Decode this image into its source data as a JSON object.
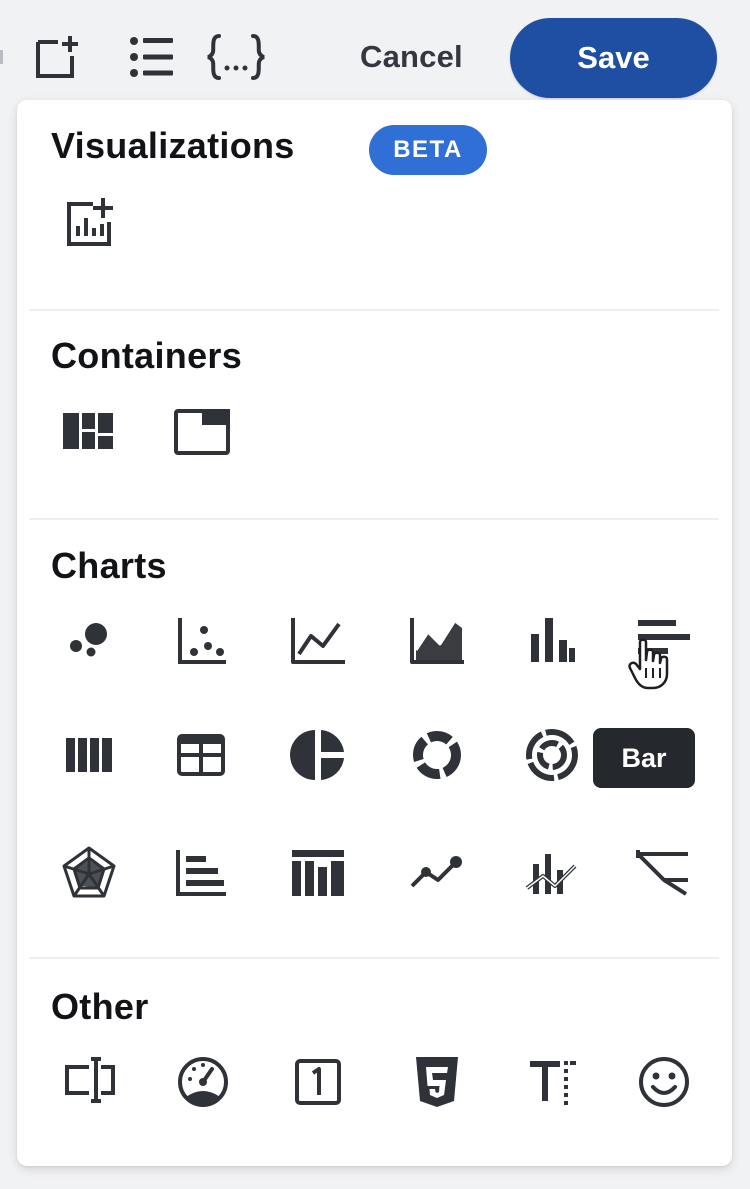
{
  "toolbar": {
    "cancel_label": "Cancel",
    "save_label": "Save",
    "icons": [
      "add-panel-icon",
      "list-icon",
      "variables-icon"
    ]
  },
  "sections": {
    "visualizations": {
      "title": "Visualizations",
      "badge": "BETA",
      "icons": [
        "add-visualization-icon"
      ]
    },
    "containers": {
      "title": "Containers",
      "icons": [
        "grid-layout-icon",
        "tabs-container-icon"
      ]
    },
    "charts": {
      "title": "Charts",
      "icons": [
        "bubble-chart-icon",
        "scatter-chart-icon",
        "line-chart-icon",
        "area-chart-icon",
        "column-chart-icon",
        "bar-chart-icon",
        "stacked-column-icon",
        "table-icon",
        "pie-chart-icon",
        "donut-chart-icon",
        "sunburst-chart-icon",
        "bar-chart-tooltip",
        "radar-chart-icon",
        "horizontal-bar-icon",
        "stacked-bar-icon",
        "trend-line-icon",
        "combo-chart-icon",
        "funnel-chart-icon"
      ]
    },
    "other": {
      "title": "Other",
      "icons": [
        "text-input-icon",
        "gauge-icon",
        "single-value-icon",
        "html5-icon",
        "text-icon",
        "emoji-icon"
      ]
    }
  },
  "tooltip": {
    "label": "Bar"
  },
  "colors": {
    "save": "#1e4fa3",
    "beta": "#2f6fd6",
    "icon": "#2f3238",
    "tooltip": "#25282d"
  }
}
